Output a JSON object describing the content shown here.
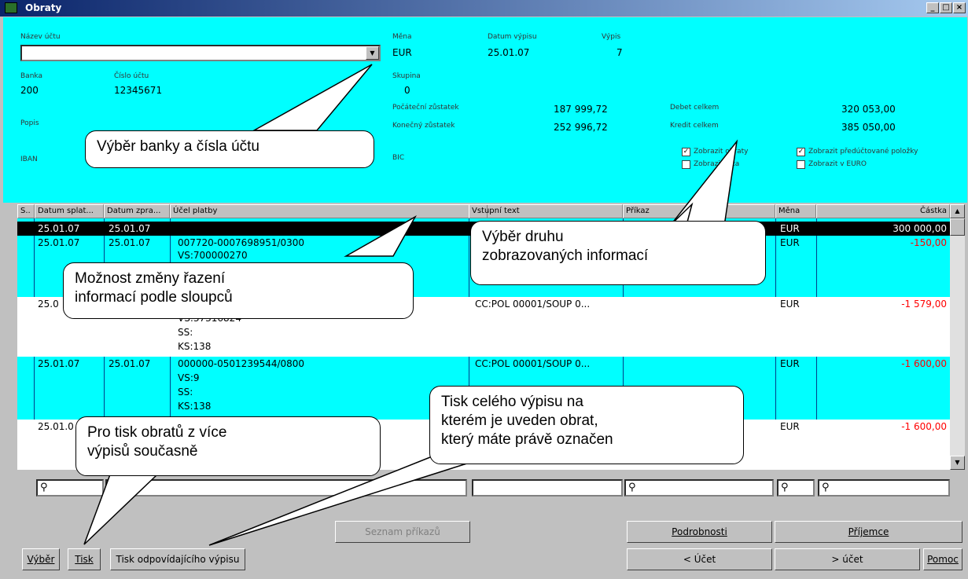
{
  "window": {
    "title": "Obraty",
    "controls": [
      "_",
      "□",
      "×"
    ]
  },
  "header": {
    "nazev_uctu_label": "Název účtu",
    "nazev_uctu_value": "",
    "mena_label": "Měna",
    "mena_value": "EUR",
    "datum_label": "Datum výpisu",
    "datum_value": "25.01.07",
    "vypis_label": "Výpis",
    "vypis_value": "7",
    "banka_label": "Banka",
    "banka_value": "200",
    "cislo_label": "Číslo účtu",
    "cislo_value": "12345671",
    "skupina_label": "Skupina",
    "skupina_value": "0",
    "poc_label": "Počáteční zůstatek",
    "poc_value": "187 999,72",
    "kon_label": "Konečný zůstatek",
    "kon_value": "252 996,72",
    "debet_label": "Debet celkem",
    "debet_value": "320 053,00",
    "kredit_label": "Kredit celkem",
    "kredit_value": "385 050,00",
    "popis_label": "Popis",
    "iban_label": "IBAN",
    "bic_label": "BIC",
    "cb1": "Zobrazit obraty",
    "cb2": "Zobrazit víza",
    "cb3": "Zobrazit předúčtované položky",
    "cb4": "Zobrazit v EURO"
  },
  "grid": {
    "columns": [
      "S..",
      "Datum splat...",
      "Datum zpra...",
      "Účel platby",
      "Vstupní text",
      "Příkaz",
      "Měna",
      "Částka"
    ],
    "rows": [
      {
        "s": "",
        "splat": "25.01.07",
        "zpra": "25.01.07",
        "ucel": "",
        "vstup": "",
        "prikaz": "",
        "mena": "EUR",
        "castka": "300 000,00"
      },
      {
        "s": "",
        "splat": "25.01.07",
        "zpra": "25.01.07",
        "ucel": "007720-0007698951/0300",
        "ucel2": "VS:700000270",
        "vstup": "",
        "prikaz": "",
        "mena": "EUR",
        "castka": "-150,00"
      },
      {
        "s": "",
        "splat": "25.0",
        "zpra": "",
        "ucel": "",
        "ucel2": "VS:37316824",
        "ucel3": "SS:",
        "ucel4": "KS:138",
        "vstup": "CC:POL 00001/SOUP 0...",
        "prikaz": "",
        "mena": "EUR",
        "castka": "-1 579,00"
      },
      {
        "s": "",
        "splat": "25.01.07",
        "zpra": "25.01.07",
        "ucel": "000000-0501239544/0800",
        "ucel2": "VS:9",
        "ucel3": "SS:",
        "ucel4": "KS:138",
        "vstup": "CC:POL 00001/SOUP 0...",
        "prikaz": "",
        "mena": "EUR",
        "castka": "-1 600,00"
      },
      {
        "s": "",
        "splat": "25.01.0",
        "zpra": "",
        "ucel": "",
        "vstup": "",
        "prikaz": "",
        "mena": "EUR",
        "castka": "-1 600,00"
      }
    ]
  },
  "buttons": {
    "vyber": "Výběr",
    "tisk": "Tisk",
    "tisk_vypisu": "Tisk odpovídajícího výpisu",
    "seznam": "Seznam příkazů",
    "podrobnosti": "Podrobnosti",
    "prijemce": "Příjemce",
    "ucet_prev": "< Účet",
    "ucet_next": "> účet",
    "pomoc": "Pomoc"
  },
  "callouts": {
    "c1": "Výběr banky a čísla účtu",
    "c2a": "Výběr druhu",
    "c2b": "zobrazovaných informací",
    "c3a": "Možnost změny řazení",
    "c3b": "informací podle sloupců",
    "c4a": "Pro tisk obratů z více",
    "c4b": "výpisů současně",
    "c5a": "Tisk celého výpisu na",
    "c5b": "kterém je uveden obrat,",
    "c5c": "který máte právě označen"
  },
  "colors": {
    "header_bg": "#00ffff",
    "selected_row_bg": "#000000",
    "negative_amount": "#ff0000"
  }
}
